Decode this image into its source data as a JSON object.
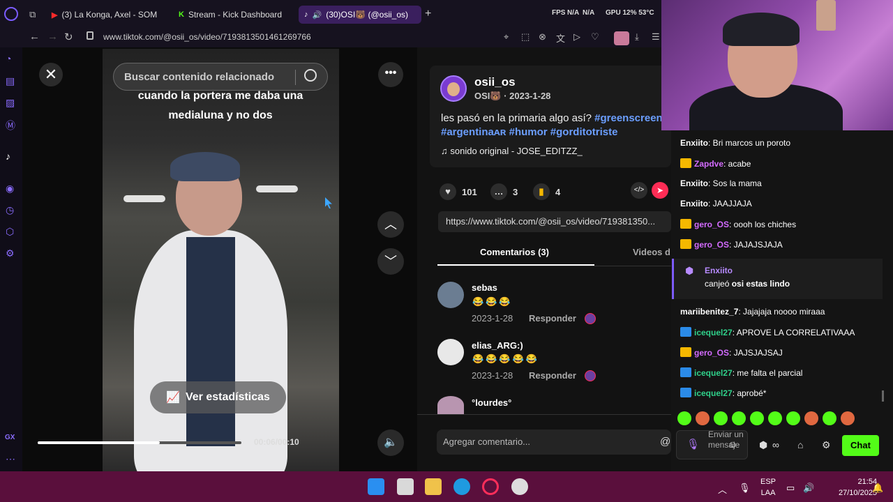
{
  "browser": {
    "tabs": [
      {
        "label": "(3) La Konga, Axel - SOM"
      },
      {
        "label": "Stream - Kick Dashboard"
      },
      {
        "label": "(30)OSI🐻 (@osii_os)"
      }
    ],
    "sysinfo": {
      "fps": "FPS",
      "na1": "N/A",
      "na2": "N/A",
      "gpu": "GPU 12% 53°C"
    },
    "url": "www.tiktok.com/@osii_os/video/7193813501461269766"
  },
  "video": {
    "search_placeholder": "Buscar contenido relacionado",
    "caption": "cuando la portera me daba una medialuna y no dos",
    "stats_button": "Ver estadísticas",
    "time": "00:06/00:10",
    "progress": 0.6
  },
  "post": {
    "username": "osii_os",
    "subline": "OSI🐻 · 2023-1-28",
    "desc_text": "les pasó en la primaria algo así?",
    "tags": [
      "#greenscreen",
      "#argentinaᴀʀ",
      "#humor",
      "#gorditotriste"
    ],
    "sound": "sonido original - JOSE_EDITZZ_",
    "likes": "101",
    "comments": "3",
    "saves": "4",
    "link": "https://www.tiktok.com/@osii_os/video/719381350...",
    "tab_comments": "Comentarios (3)",
    "tab_videos": "Videos d",
    "add_comment": "Agregar comentario..."
  },
  "comments": [
    {
      "user": "sebas",
      "emojis": "😂😂😂",
      "date": "2023-1-28",
      "reply": "Responder"
    },
    {
      "user": "elias_ARG:)",
      "emojis": "😂😂😂😂😂",
      "date": "2023-1-28",
      "reply": "Responder"
    },
    {
      "user": "°lourdes°",
      "emojis": "",
      "date": "",
      "reply": ""
    }
  ],
  "chat": {
    "messages": [
      {
        "user": "Enxiito",
        "text": ": Bri marcos un poroto",
        "color": "#ffffff",
        "badge": ""
      },
      {
        "user": "Zapdve",
        "text": ": acabe",
        "color": "#d36bff",
        "badge": "crown"
      },
      {
        "user": "Enxiito",
        "text": ": Sos la mama",
        "color": "#ffffff",
        "badge": ""
      },
      {
        "user": "Enxiito",
        "text": ": JAAJJAJA",
        "color": "#ffffff",
        "badge": ""
      },
      {
        "user": "gero_OS",
        "text": ": oooh los chiches",
        "color": "#d36bff",
        "badge": "crown"
      },
      {
        "user": "gero_OS",
        "text": ": JAJAJSJAJA",
        "color": "#d36bff",
        "badge": "crown"
      },
      {
        "user": "mariibenitez_7",
        "text": ": Jajajaja noooo miraaa",
        "color": "#ffffff",
        "badge": ""
      },
      {
        "user": "icequel27",
        "text": ": APROVE LA CORRELATIVAAA",
        "color": "#2fd08a",
        "badge": "kick"
      },
      {
        "user": "gero_OS",
        "text": ": JAJSJAJSAJ",
        "color": "#d36bff",
        "badge": "crown"
      },
      {
        "user": "icequel27",
        "text": ": me falta el parcial",
        "color": "#2fd08a",
        "badge": "kick"
      },
      {
        "user": "icequel27",
        "text": ": aprobé*",
        "color": "#2fd08a",
        "badge": "kick"
      }
    ],
    "redeem_user": "Enxiito",
    "redeem_text_pre": "canjeó",
    "redeem_text_bold": "osi estas lindo",
    "input_placeholder": "Enviar un mensaje",
    "send_button": "Chat"
  },
  "taskbar": {
    "lang_top": "ESP",
    "lang_bottom": "LAA",
    "time": "21:54",
    "date": "27/10/2025"
  }
}
